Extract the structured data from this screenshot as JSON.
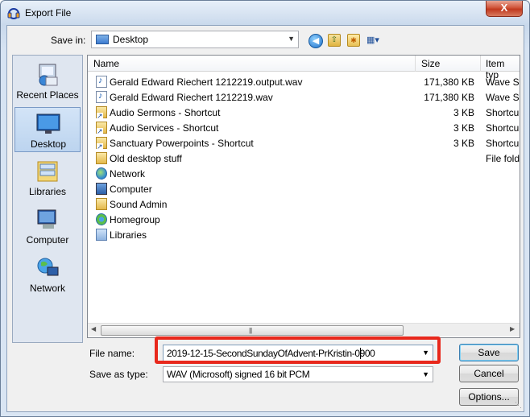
{
  "window": {
    "title": "Export File",
    "close_label": "X"
  },
  "toolbar": {
    "save_in_label": "Save in:",
    "save_in_value": "Desktop",
    "icons": [
      "back-icon",
      "up-folder-icon",
      "new-folder-icon",
      "view-menu-icon"
    ]
  },
  "places": [
    {
      "label": "Recent Places",
      "icon": "recent-places-icon"
    },
    {
      "label": "Desktop",
      "icon": "desktop-icon",
      "selected": true
    },
    {
      "label": "Libraries",
      "icon": "libraries-icon"
    },
    {
      "label": "Computer",
      "icon": "computer-icon"
    },
    {
      "label": "Network",
      "icon": "network-icon"
    }
  ],
  "columns": {
    "name": "Name",
    "size": "Size",
    "type": "Item typ"
  },
  "files": [
    {
      "name": "Gerald Edward Riechert 1212219.output.wav",
      "size": "171,380 KB",
      "type": "Wave So",
      "icon": "wav"
    },
    {
      "name": "Gerald Edward Riechert 1212219.wav",
      "size": "171,380 KB",
      "type": "Wave So",
      "icon": "wav"
    },
    {
      "name": "Audio Sermons - Shortcut",
      "size": "3 KB",
      "type": "Shortcu",
      "icon": "lnk"
    },
    {
      "name": "Audio Services - Shortcut",
      "size": "3 KB",
      "type": "Shortcu",
      "icon": "lnk"
    },
    {
      "name": "Sanctuary Powerpoints - Shortcut",
      "size": "3 KB",
      "type": "Shortcu",
      "icon": "lnk"
    },
    {
      "name": "Old desktop stuff",
      "size": "",
      "type": "File fold",
      "icon": "fold"
    },
    {
      "name": "Network",
      "size": "",
      "type": "",
      "icon": "net"
    },
    {
      "name": "Computer",
      "size": "",
      "type": "",
      "icon": "comp"
    },
    {
      "name": "Sound Admin",
      "size": "",
      "type": "",
      "icon": "user"
    },
    {
      "name": "Homegroup",
      "size": "",
      "type": "",
      "icon": "home"
    },
    {
      "name": "Libraries",
      "size": "",
      "type": "",
      "icon": "lib"
    }
  ],
  "form": {
    "file_name_label": "File name:",
    "file_name_value": "2019-12-15-SecondSundayOfAdvent-PrKristin-0900",
    "save_as_type_label": "Save as type:",
    "save_as_type_value": "WAV (Microsoft) signed 16 bit PCM"
  },
  "buttons": {
    "save": "Save",
    "cancel": "Cancel",
    "options": "Options..."
  },
  "colors": {
    "highlight": "#e8281c",
    "selected_place": "#bcd4ef"
  }
}
